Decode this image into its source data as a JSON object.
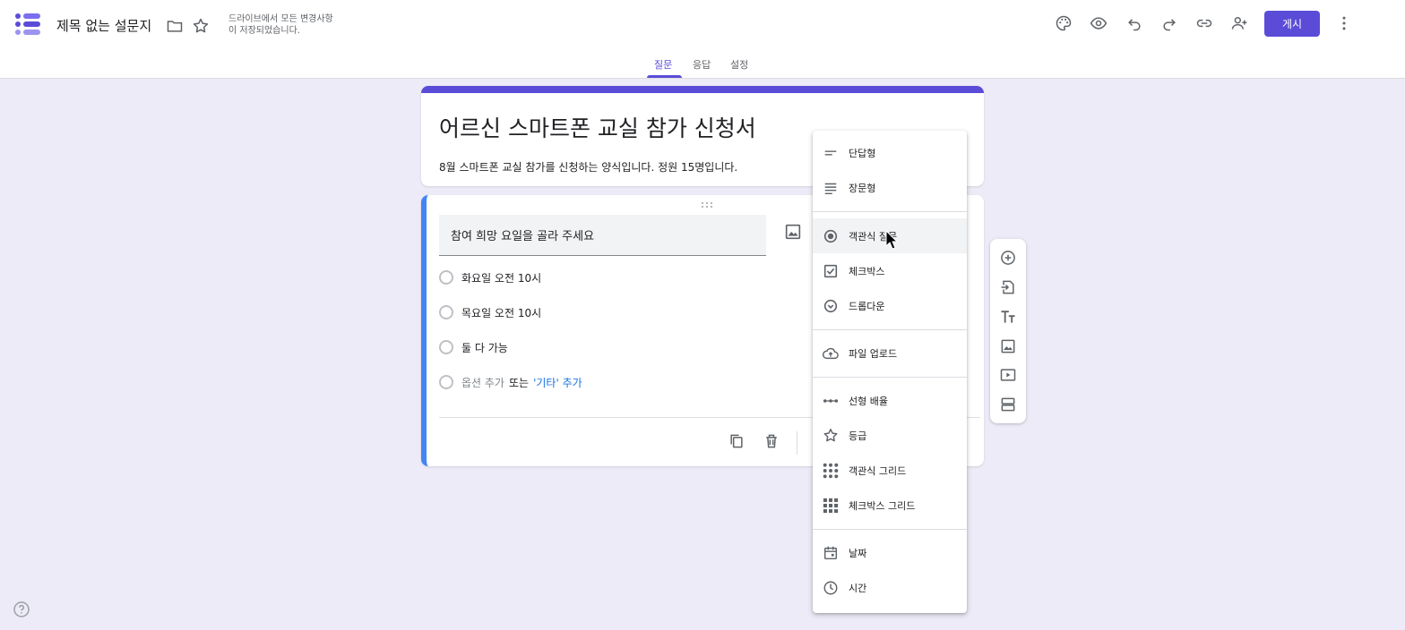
{
  "header": {
    "doc_title": "제목 없는 설문지",
    "save_status_line1": "드라이브에서 모든 변경사항",
    "save_status_line2": "이 저장되었습니다.",
    "publish_label": "게시"
  },
  "tabs": [
    {
      "label": "질문",
      "active": true
    },
    {
      "label": "응답",
      "active": false
    },
    {
      "label": "설정",
      "active": false
    }
  ],
  "form": {
    "title": "어르신 스마트폰 교실 참가 신청서",
    "description": "8월 스마트폰 교실 참가를 신청하는 양식입니다. 정원 15명입니다."
  },
  "question": {
    "text": "참여 희망 요일을 골라 주세요",
    "options": [
      "화요일 오전 10시",
      "목요일 오전 10시",
      "둘 다 가능"
    ],
    "add_option": "옵션 추가",
    "or": "또는",
    "add_other": "'기타' 추가"
  },
  "question_type_menu": {
    "items": [
      {
        "label": "단답형",
        "icon": "short-answer-icon"
      },
      {
        "label": "장문형",
        "icon": "paragraph-icon"
      },
      {
        "label": "객관식 질문",
        "icon": "radio-icon",
        "selected": true
      },
      {
        "label": "체크박스",
        "icon": "checkbox-icon"
      },
      {
        "label": "드롭다운",
        "icon": "dropdown-icon"
      },
      {
        "label": "파일 업로드",
        "icon": "upload-icon"
      },
      {
        "label": "선형 배율",
        "icon": "linear-scale-icon"
      },
      {
        "label": "등급",
        "icon": "star-icon"
      },
      {
        "label": "객관식 그리드",
        "icon": "radio-grid-icon"
      },
      {
        "label": "체크박스 그리드",
        "icon": "checkbox-grid-icon"
      },
      {
        "label": "날짜",
        "icon": "calendar-icon"
      },
      {
        "label": "시간",
        "icon": "clock-icon"
      }
    ]
  },
  "colors": {
    "accent": "#5b4cd8",
    "question_border": "#4285f4",
    "background": "#ecebf7"
  }
}
